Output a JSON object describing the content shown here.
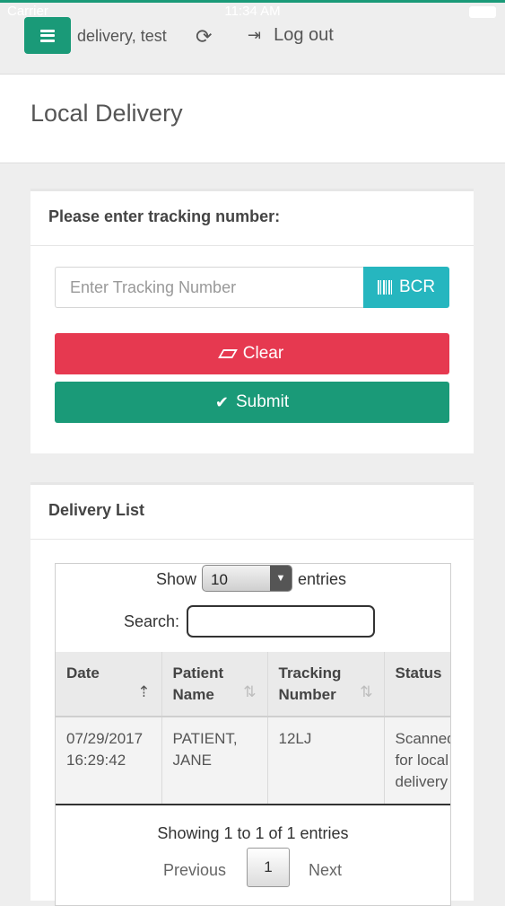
{
  "statusbar": {
    "carrier": "Carrier",
    "time": "11:34 AM"
  },
  "topbar": {
    "user": "delivery, test",
    "logout_label": "Log out"
  },
  "page": {
    "title": "Local Delivery"
  },
  "tracking": {
    "heading": "Please enter tracking number:",
    "input_placeholder": "Enter Tracking Number",
    "input_value": "",
    "bcr_label": "BCR",
    "clear_label": "Clear",
    "submit_label": "Submit"
  },
  "delivery_list": {
    "heading": "Delivery List",
    "show_label": "Show",
    "entries_value": "10",
    "entries_label": "entries",
    "search_label": "Search:",
    "search_value": "",
    "columns": [
      "Date",
      "Patient Name",
      "Tracking Number",
      "Status"
    ],
    "rows": [
      {
        "date": "07/29/2017 16:29:42",
        "patient": "PATIENT, JANE",
        "tracking": "12LJ",
        "status": "Scanned for local delivery"
      }
    ],
    "info": "Showing 1 to 1 of 1 entries",
    "previous_label": "Previous",
    "current_page": "1",
    "next_label": "Next"
  },
  "colors": {
    "primary": "#1a9a78",
    "info": "#26b6bf",
    "danger": "#e63950"
  }
}
